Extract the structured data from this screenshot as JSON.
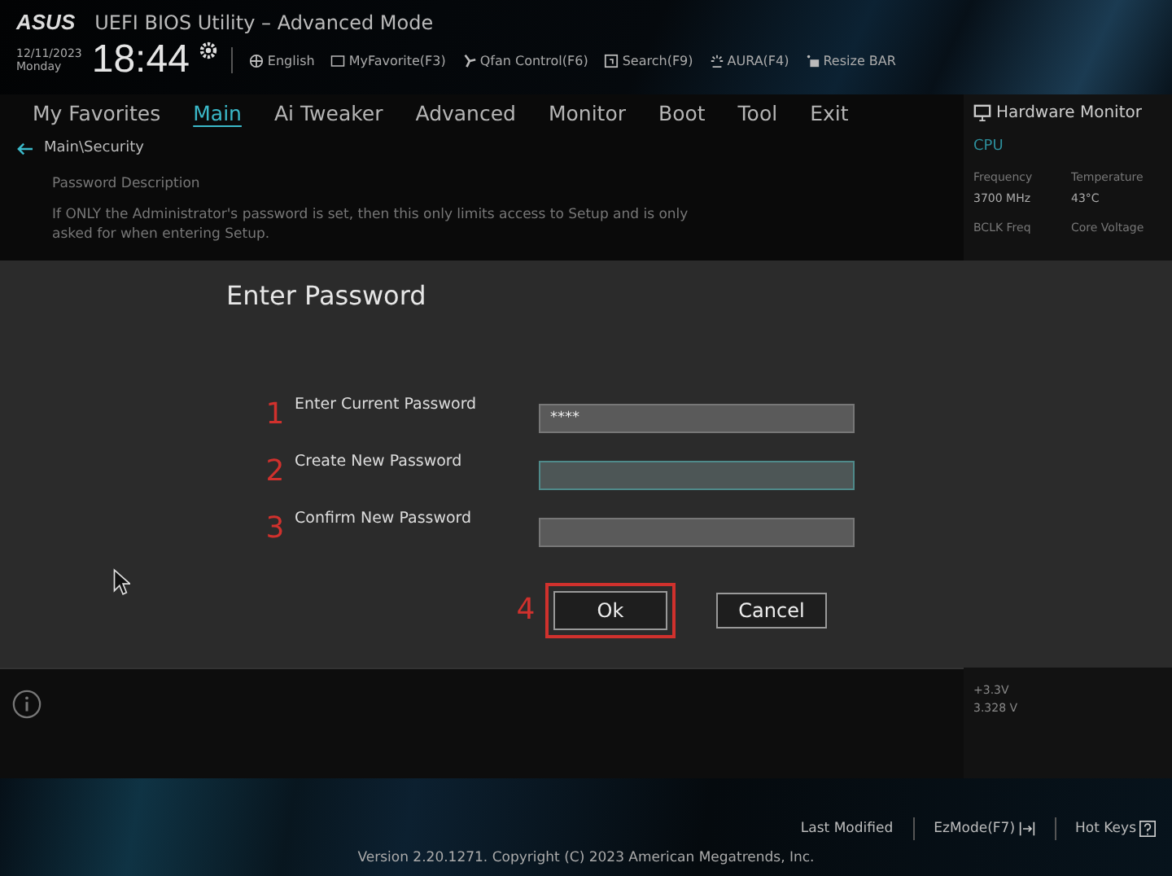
{
  "header": {
    "brand": "ASUS",
    "title": "UEFI BIOS Utility – Advanced Mode",
    "date": "12/11/2023",
    "day": "Monday",
    "time": "18:44",
    "tools": [
      {
        "label": "English",
        "kind": "globe"
      },
      {
        "label": "MyFavorite(F3)",
        "kind": "star"
      },
      {
        "label": "Qfan Control(F6)",
        "kind": "fan"
      },
      {
        "label": "Search(F9)",
        "kind": "search"
      },
      {
        "label": "AURA(F4)",
        "kind": "aura"
      },
      {
        "label": "Resize BAR",
        "kind": "bar"
      }
    ]
  },
  "tabs": [
    {
      "label": "My Favorites",
      "selected": false
    },
    {
      "label": "Main",
      "selected": true
    },
    {
      "label": "Ai Tweaker",
      "selected": false
    },
    {
      "label": "Advanced",
      "selected": false
    },
    {
      "label": "Monitor",
      "selected": false
    },
    {
      "label": "Boot",
      "selected": false
    },
    {
      "label": "Tool",
      "selected": false
    },
    {
      "label": "Exit",
      "selected": false
    }
  ],
  "breadcrumb": "Main\\Security",
  "description": {
    "title": "Password Description",
    "text": "If ONLY the Administrator's password is set, then this only limits access to Setup and is only asked for when entering Setup."
  },
  "hardware_monitor": {
    "title": "Hardware Monitor",
    "section": "CPU",
    "rows": [
      [
        "Frequency",
        "Temperature"
      ],
      [
        "3700 MHz",
        "43°C"
      ],
      [
        "BCLK Freq",
        "Core Voltage"
      ]
    ],
    "lower": [
      "+3.3V",
      "3.328 V"
    ]
  },
  "dialog": {
    "title": "Enter Password",
    "fields": [
      {
        "step": "1",
        "label": "Enter Current Password",
        "value": "****",
        "focused": false
      },
      {
        "step": "2",
        "label": "Create New Password",
        "focused": true
      },
      {
        "step": "3",
        "label": "Confirm New Password",
        "focused": false
      }
    ],
    "buttons": [
      {
        "label": "Ok",
        "step": "4",
        "highlighted": true
      },
      {
        "label": "Cancel",
        "highlighted": false
      }
    ]
  },
  "footer": {
    "items": [
      {
        "label": "Last Modified",
        "kind": "plain"
      },
      {
        "label": "EzMode(F7)",
        "kind": "exit"
      },
      {
        "label": "Hot Keys",
        "kind": "help"
      }
    ],
    "version": "Version 2.20.1271. Copyright (C) 2023 American Megatrends, Inc."
  }
}
